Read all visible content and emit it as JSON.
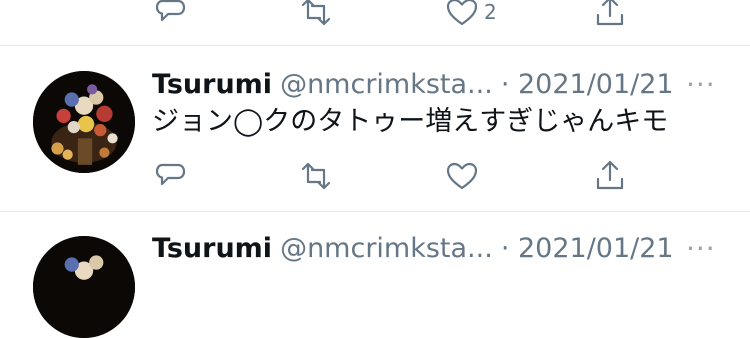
{
  "prev_tweet": {
    "likes": "2"
  },
  "tweet": {
    "display_name": "Tsurumi",
    "handle": "@nmcrimksta...",
    "date": "· 2021/01/21",
    "more": "···",
    "text": "ジョン◯クのタトゥー増えすぎじゃんキモ"
  },
  "next_tweet": {
    "display_name": "Tsurumi",
    "handle": "@nmcrimksta...",
    "date": "· 2021/01/21",
    "more": "···"
  },
  "icons": [
    "reply-icon",
    "retweet-icon",
    "like-icon",
    "share-icon",
    "more-icon"
  ]
}
